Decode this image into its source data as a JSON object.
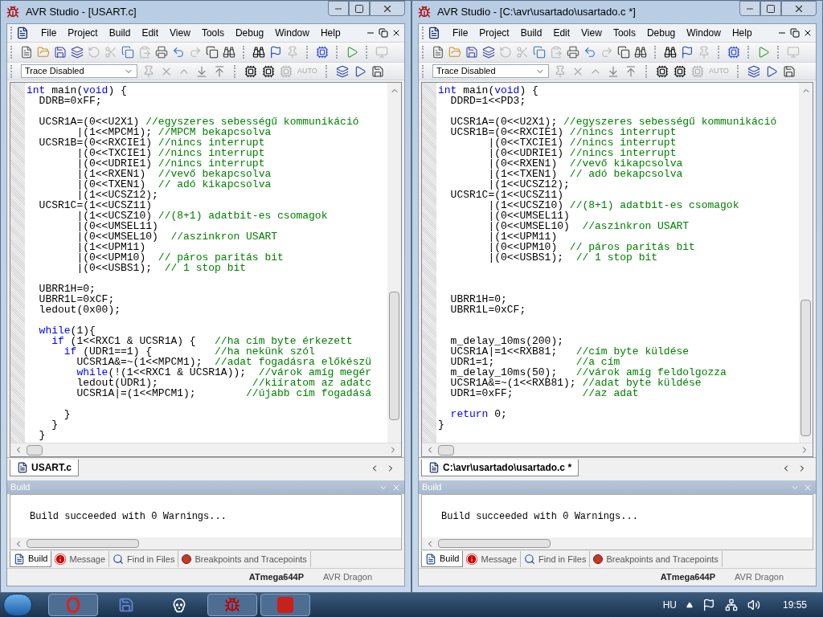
{
  "windows": [
    {
      "title": "AVR Studio - [USART.c]",
      "menu": [
        "File",
        "Project",
        "Build",
        "Edit",
        "View",
        "Tools",
        "Debug",
        "Window",
        "Help"
      ],
      "trace_dropdown": "Trace Disabled",
      "auto_label": "AUTO",
      "code": [
        {
          "kind": "code",
          "segments": [
            {
              "kind": "keyword",
              "text": "int"
            },
            {
              "kind": "plain",
              "text": " main("
            },
            {
              "kind": "keyword",
              "text": "void"
            },
            {
              "kind": "plain",
              "text": ") {"
            }
          ]
        },
        {
          "kind": "code",
          "segments": [
            {
              "kind": "plain",
              "text": "  DDRB=0xFF;"
            }
          ]
        },
        {
          "kind": "blank"
        },
        {
          "kind": "code",
          "segments": [
            {
              "kind": "plain",
              "text": "  UCSR1A=(0<<U2X1) "
            },
            {
              "kind": "comment",
              "text": "//egyszeres sebességű kommunikáció"
            }
          ]
        },
        {
          "kind": "code",
          "segments": [
            {
              "kind": "plain",
              "text": "        |(1<<MPCM1); "
            },
            {
              "kind": "comment",
              "text": "//MPCM bekapcsolva"
            }
          ]
        },
        {
          "kind": "code",
          "segments": [
            {
              "kind": "plain",
              "text": "  UCSR1B=(0<<RXCIE1) "
            },
            {
              "kind": "comment",
              "text": "//nincs interrupt"
            }
          ]
        },
        {
          "kind": "code",
          "segments": [
            {
              "kind": "plain",
              "text": "        |(0<<TXCIE1) "
            },
            {
              "kind": "comment",
              "text": "//nincs interrupt"
            }
          ]
        },
        {
          "kind": "code",
          "segments": [
            {
              "kind": "plain",
              "text": "        |(0<<UDRIE1) "
            },
            {
              "kind": "comment",
              "text": "//nincs interrupt"
            }
          ]
        },
        {
          "kind": "code",
          "segments": [
            {
              "kind": "plain",
              "text": "        |(1<<RXEN1)  "
            },
            {
              "kind": "comment",
              "text": "//vevő bekapcsolva"
            }
          ]
        },
        {
          "kind": "code",
          "segments": [
            {
              "kind": "plain",
              "text": "        |(0<<TXEN1)  "
            },
            {
              "kind": "comment",
              "text": "// adó kikapcsolva"
            }
          ]
        },
        {
          "kind": "code",
          "segments": [
            {
              "kind": "plain",
              "text": "        |(1<<UCSZ12);"
            }
          ]
        },
        {
          "kind": "code",
          "segments": [
            {
              "kind": "plain",
              "text": "  UCSR1C=(1<<UCSZ11)"
            }
          ]
        },
        {
          "kind": "code",
          "segments": [
            {
              "kind": "plain",
              "text": "        |(1<<UCSZ10) "
            },
            {
              "kind": "comment",
              "text": "//(8+1) adatbit-es csomagok"
            }
          ]
        },
        {
          "kind": "code",
          "segments": [
            {
              "kind": "plain",
              "text": "        |(0<<UMSEL11)"
            }
          ]
        },
        {
          "kind": "code",
          "segments": [
            {
              "kind": "plain",
              "text": "        |(0<<UMSEL10)  "
            },
            {
              "kind": "comment",
              "text": "//aszinkron USART"
            }
          ]
        },
        {
          "kind": "code",
          "segments": [
            {
              "kind": "plain",
              "text": "        |(1<<UPM11)"
            }
          ]
        },
        {
          "kind": "code",
          "segments": [
            {
              "kind": "plain",
              "text": "        |(0<<UPM10)  "
            },
            {
              "kind": "comment",
              "text": "// páros paritás bit"
            }
          ]
        },
        {
          "kind": "code",
          "segments": [
            {
              "kind": "plain",
              "text": "        |(0<<USBS1);  "
            },
            {
              "kind": "comment",
              "text": "// 1 stop bit"
            }
          ]
        },
        {
          "kind": "blank"
        },
        {
          "kind": "code",
          "segments": [
            {
              "kind": "plain",
              "text": "  UBRR1H=0;"
            }
          ]
        },
        {
          "kind": "code",
          "segments": [
            {
              "kind": "plain",
              "text": "  UBRR1L=0xCF;"
            }
          ]
        },
        {
          "kind": "code",
          "segments": [
            {
              "kind": "plain",
              "text": "  ledout(0x00);"
            }
          ]
        },
        {
          "kind": "blank"
        },
        {
          "kind": "code",
          "segments": [
            {
              "kind": "keyword",
              "text": "  while"
            },
            {
              "kind": "plain",
              "text": "(1){"
            }
          ]
        },
        {
          "kind": "code",
          "segments": [
            {
              "kind": "keyword",
              "text": "    if"
            },
            {
              "kind": "plain",
              "text": " (1<<RXC1 & UCSR1A) {   "
            },
            {
              "kind": "comment",
              "text": "//ha cím byte érkezett"
            }
          ]
        },
        {
          "kind": "code",
          "segments": [
            {
              "kind": "keyword",
              "text": "      if"
            },
            {
              "kind": "plain",
              "text": " (UDR1==1) {          "
            },
            {
              "kind": "comment",
              "text": "//ha nekünk szól"
            }
          ]
        },
        {
          "kind": "code",
          "segments": [
            {
              "kind": "plain",
              "text": "        UCSR1A&=~(1<<MPCM1);  "
            },
            {
              "kind": "comment",
              "text": "//adat fogadásra előkészü"
            }
          ]
        },
        {
          "kind": "code",
          "segments": [
            {
              "kind": "keyword",
              "text": "        while"
            },
            {
              "kind": "plain",
              "text": "(!(1<<RXC1 & UCSR1A));  "
            },
            {
              "kind": "comment",
              "text": "//várok amíg megér"
            }
          ]
        },
        {
          "kind": "code",
          "segments": [
            {
              "kind": "plain",
              "text": "        ledout(UDR1);               "
            },
            {
              "kind": "comment",
              "text": "//kiíratom az adatc"
            }
          ]
        },
        {
          "kind": "code",
          "segments": [
            {
              "kind": "plain",
              "text": "        UCSR1A|=(1<<MPCM1);        "
            },
            {
              "kind": "comment",
              "text": "//újabb cím fogadásá"
            }
          ]
        },
        {
          "kind": "blank"
        },
        {
          "kind": "code",
          "segments": [
            {
              "kind": "plain",
              "text": "      }"
            }
          ]
        },
        {
          "kind": "code",
          "segments": [
            {
              "kind": "plain",
              "text": "    }"
            }
          ]
        },
        {
          "kind": "code",
          "segments": [
            {
              "kind": "plain",
              "text": "  }"
            }
          ]
        }
      ],
      "doc_tab": "USART.c",
      "panel_title": "Build",
      "output": "Build succeeded with 0 Warnings...",
      "panel_tabs": [
        {
          "label": "Build",
          "kind": "build",
          "selected": true
        },
        {
          "label": "Message",
          "kind": "message",
          "selected": false
        },
        {
          "label": "Find in Files",
          "kind": "find",
          "selected": false
        },
        {
          "label": "Breakpoints and Tracepoints",
          "kind": "breakpoints",
          "selected": false
        }
      ],
      "status": {
        "device": "ATmega644P",
        "tool": "AVR Dragon"
      }
    },
    {
      "title": "AVR Studio - [C:\\avr\\usartado\\usartado.c *]",
      "menu": [
        "File",
        "Project",
        "Build",
        "Edit",
        "View",
        "Tools",
        "Debug",
        "Window",
        "Help"
      ],
      "trace_dropdown": "Trace Disabled",
      "auto_label": "AUTO",
      "code": [
        {
          "kind": "code",
          "segments": [
            {
              "kind": "keyword",
              "text": "int"
            },
            {
              "kind": "plain",
              "text": " main("
            },
            {
              "kind": "keyword",
              "text": "void"
            },
            {
              "kind": "plain",
              "text": ") {"
            }
          ]
        },
        {
          "kind": "code",
          "segments": [
            {
              "kind": "plain",
              "text": "  DDRD=1<<PD3;"
            }
          ]
        },
        {
          "kind": "blank"
        },
        {
          "kind": "code",
          "segments": [
            {
              "kind": "plain",
              "text": "  UCSR1A=(0<<U2X1); "
            },
            {
              "kind": "comment",
              "text": "//egyszeres sebességű kommunikáció"
            }
          ]
        },
        {
          "kind": "code",
          "segments": [
            {
              "kind": "plain",
              "text": "  UCSR1B=(0<<RXCIE1) "
            },
            {
              "kind": "comment",
              "text": "//nincs interrupt"
            }
          ]
        },
        {
          "kind": "code",
          "segments": [
            {
              "kind": "plain",
              "text": "        |(0<<TXCIE1) "
            },
            {
              "kind": "comment",
              "text": "//nincs interrupt"
            }
          ]
        },
        {
          "kind": "code",
          "segments": [
            {
              "kind": "plain",
              "text": "        |(0<<UDRIE1) "
            },
            {
              "kind": "comment",
              "text": "//nincs interrupt"
            }
          ]
        },
        {
          "kind": "code",
          "segments": [
            {
              "kind": "plain",
              "text": "        |(0<<RXEN1)  "
            },
            {
              "kind": "comment",
              "text": "//vevő kikapcsolva"
            }
          ]
        },
        {
          "kind": "code",
          "segments": [
            {
              "kind": "plain",
              "text": "        |(1<<TXEN1)  "
            },
            {
              "kind": "comment",
              "text": "// adó bekapcsolva"
            }
          ]
        },
        {
          "kind": "code",
          "segments": [
            {
              "kind": "plain",
              "text": "        |(1<<UCSZ12);"
            }
          ]
        },
        {
          "kind": "code",
          "segments": [
            {
              "kind": "plain",
              "text": "  UCSR1C=(1<<UCSZ11)"
            }
          ]
        },
        {
          "kind": "code",
          "segments": [
            {
              "kind": "plain",
              "text": "        |(1<<UCSZ10) "
            },
            {
              "kind": "comment",
              "text": "//(8+1) adatbit-es csomagok"
            }
          ]
        },
        {
          "kind": "code",
          "segments": [
            {
              "kind": "plain",
              "text": "        |(0<<UMSEL11)"
            }
          ]
        },
        {
          "kind": "code",
          "segments": [
            {
              "kind": "plain",
              "text": "        |(0<<UMSEL10)  "
            },
            {
              "kind": "comment",
              "text": "//aszinkron USART"
            }
          ]
        },
        {
          "kind": "code",
          "segments": [
            {
              "kind": "plain",
              "text": "        |(1<<UPM11)"
            }
          ]
        },
        {
          "kind": "code",
          "segments": [
            {
              "kind": "plain",
              "text": "        |(0<<UPM10)  "
            },
            {
              "kind": "comment",
              "text": "// páros paritás bit"
            }
          ]
        },
        {
          "kind": "code",
          "segments": [
            {
              "kind": "plain",
              "text": "        |(0<<USBS1);  "
            },
            {
              "kind": "comment",
              "text": "// 1 stop bit"
            }
          ]
        },
        {
          "kind": "blank"
        },
        {
          "kind": "blank"
        },
        {
          "kind": "blank"
        },
        {
          "kind": "code",
          "segments": [
            {
              "kind": "plain",
              "text": "  UBRR1H=0;"
            }
          ]
        },
        {
          "kind": "code",
          "segments": [
            {
              "kind": "plain",
              "text": "  UBRR1L=0xCF;"
            }
          ]
        },
        {
          "kind": "blank"
        },
        {
          "kind": "blank"
        },
        {
          "kind": "code",
          "segments": [
            {
              "kind": "plain",
              "text": "  m_delay_10ms(200);"
            }
          ]
        },
        {
          "kind": "code",
          "segments": [
            {
              "kind": "plain",
              "text": "  UCSR1A|=1<<RXB81;   "
            },
            {
              "kind": "comment",
              "text": "//cím byte küldése"
            }
          ]
        },
        {
          "kind": "code",
          "segments": [
            {
              "kind": "plain",
              "text": "  UDR1=1;             "
            },
            {
              "kind": "comment",
              "text": "//a cím"
            }
          ]
        },
        {
          "kind": "code",
          "segments": [
            {
              "kind": "plain",
              "text": "  m_delay_10ms(50);   "
            },
            {
              "kind": "comment",
              "text": "//várok amíg feldolgozza"
            }
          ]
        },
        {
          "kind": "code",
          "segments": [
            {
              "kind": "plain",
              "text": "  UCSR1A&=~(1<<RXB81); "
            },
            {
              "kind": "comment",
              "text": "//adat byte küldése"
            }
          ]
        },
        {
          "kind": "code",
          "segments": [
            {
              "kind": "plain",
              "text": "  UDR1=0xFF;           "
            },
            {
              "kind": "comment",
              "text": "//az adat"
            }
          ]
        },
        {
          "kind": "blank"
        },
        {
          "kind": "code",
          "segments": [
            {
              "kind": "keyword",
              "text": "  return"
            },
            {
              "kind": "plain",
              "text": " 0;"
            }
          ]
        },
        {
          "kind": "code",
          "segments": [
            {
              "kind": "plain",
              "text": "}"
            }
          ]
        }
      ],
      "doc_tab": "C:\\avr\\usartado\\usartado.c *",
      "panel_title": "Build",
      "output": "Build succeeded with 0 Warnings...",
      "panel_tabs": [
        {
          "label": "Build",
          "kind": "build",
          "selected": true
        },
        {
          "label": "Message",
          "kind": "message",
          "selected": false
        },
        {
          "label": "Find in Files",
          "kind": "find",
          "selected": false
        },
        {
          "label": "Breakpoints and Tracepoints",
          "kind": "breakpoints",
          "selected": false
        }
      ],
      "status": {
        "device": "ATmega644P",
        "tool": "AVR Dragon"
      }
    }
  ],
  "taskbar": {
    "apps": [
      {
        "kind": "browser",
        "open": true
      },
      {
        "kind": "floppy",
        "open": false
      },
      {
        "kind": "skull",
        "open": false
      },
      {
        "kind": "bug",
        "open": true
      },
      {
        "kind": "pdf",
        "open": true
      }
    ],
    "language": "HU",
    "time": "19:55"
  }
}
